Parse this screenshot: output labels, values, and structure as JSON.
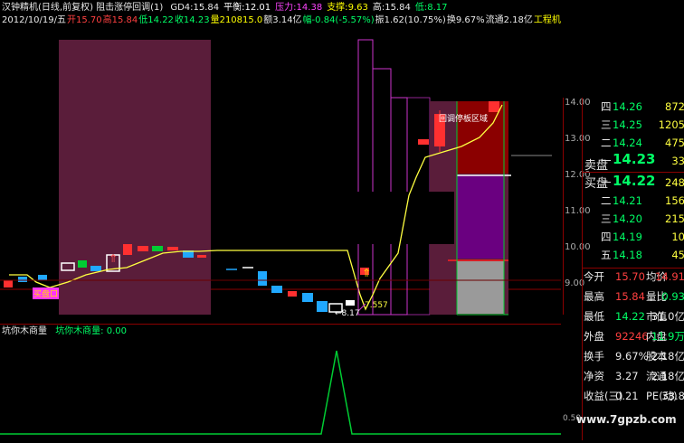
{
  "header": {
    "line1": [
      {
        "text": "汉钟精机(日线,前复权) 阻击涨停回调(1)",
        "color": "#e8e8e8"
      },
      {
        "text": "GD4:",
        "color": "#e8e8e8"
      },
      {
        "text": "15.84",
        "color": "#e8e8e8"
      },
      {
        "text": "平衡:",
        "color": "#ffffff"
      },
      {
        "text": "12.01",
        "color": "#ffffff"
      },
      {
        "text": "压力:",
        "color": "#ff44ff"
      },
      {
        "text": "14.38",
        "color": "#ff44ff"
      },
      {
        "text": "支撑:",
        "color": "#ffff00"
      },
      {
        "text": "9.63",
        "color": "#ffff00"
      },
      {
        "text": "高:",
        "color": "#e8e8e8"
      },
      {
        "text": "15.84",
        "color": "#e8e8e8"
      },
      {
        "text": "低:",
        "color": "#00ff66"
      },
      {
        "text": "8.17",
        "color": "#00ff66"
      }
    ],
    "line2": [
      {
        "text": "2012/10/19/五",
        "color": "#e8e8e8"
      },
      {
        "text": "开15.70",
        "color": "#ff4040"
      },
      {
        "text": "高15.84",
        "color": "#ff4040"
      },
      {
        "text": "低14.22",
        "color": "#00ff66"
      },
      {
        "text": "收14.23",
        "color": "#00ff66"
      },
      {
        "text": "量210815.0",
        "color": "#ffff00"
      },
      {
        "text": "额3.14亿",
        "color": "#e8e8e8"
      },
      {
        "text": "幅-0.84(-5.57%)",
        "color": "#00ff66"
      },
      {
        "text": "振1.62(10.75%)",
        "color": "#e8e8e8"
      },
      {
        "text": "换9.67%",
        "color": "#e8e8e8"
      },
      {
        "text": "流通2.18亿",
        "color": "#e8e8e8"
      },
      {
        "text": "工程机",
        "color": "#ffff00"
      }
    ]
  },
  "price_axis": {
    "ticks": [
      "14.00",
      "13.00",
      "12.00",
      "11.00",
      "10.00",
      "9.00"
    ]
  },
  "annotations": {
    "buy_label": "买盘口",
    "low_label": "←8.17",
    "mid_label": "7.557",
    "zone_label": "回调停板区域"
  },
  "indicator": {
    "name": "坑你木商量",
    "label": "坑你木商量:",
    "value": "0.00",
    "axis_label": "0.50"
  },
  "order_book": {
    "asks": [
      {
        "level": "四",
        "price": "14.26",
        "vol": "872"
      },
      {
        "level": "三",
        "price": "14.25",
        "vol": "1205"
      },
      {
        "level": "二",
        "price": "14.24",
        "vol": "475"
      },
      {
        "level": "一",
        "price": "14.23",
        "vol": "33"
      }
    ],
    "ask_label": "卖盘",
    "bid_label": "买盘",
    "bids": [
      {
        "level": "一",
        "price": "14.22",
        "vol": "248"
      },
      {
        "level": "二",
        "price": "14.21",
        "vol": "156"
      },
      {
        "level": "三",
        "price": "14.20",
        "vol": "215"
      },
      {
        "level": "四",
        "price": "14.19",
        "vol": "10"
      },
      {
        "level": "五",
        "price": "14.18",
        "vol": "45"
      }
    ]
  },
  "stats": [
    {
      "l1": "今开",
      "v1": "15.70",
      "c1": "#ff4040",
      "l2": "均价",
      "v2": "14.91",
      "c2": "#ff4040"
    },
    {
      "l1": "最高",
      "v1": "15.84",
      "c1": "#ff4040",
      "l2": "量比",
      "v2": "0.93",
      "c2": "#00ff66"
    },
    {
      "l1": "最低",
      "v1": "14.22",
      "c1": "#00ff66",
      "l2": "市值",
      "v2": "31.0亿",
      "c2": "#e8e8e8"
    },
    {
      "l1": "外盘",
      "v1": "92246",
      "c1": "#ff4040",
      "l2": "内盘",
      "v2": "11.9万",
      "c2": "#00ff66"
    },
    {
      "l1": "换手",
      "v1": "9.67%",
      "c1": "#e8e8e8",
      "l2": "股本",
      "v2": "2.18亿",
      "c2": "#e8e8e8"
    },
    {
      "l1": "净资",
      "v1": "3.27",
      "c1": "#e8e8e8",
      "l2": "流通",
      "v2": "2.18亿",
      "c2": "#e8e8e8"
    },
    {
      "l1": "收益(三)",
      "v1": "0.21",
      "c1": "#e8e8e8",
      "l2": "PE(动)",
      "v2": "33.8",
      "c2": "#e8e8e8"
    }
  ],
  "watermark": "www.7gpzb.com",
  "colors": {
    "up": "#ff3030",
    "down": "#20a8ff",
    "flat": "#ffffff",
    "zone": "#5a1d3a",
    "balance": "#ffff40",
    "purple": "#7a007a",
    "magenta": "#cc33cc",
    "grid": "#8b0000",
    "indicator": "#00cc33"
  }
}
